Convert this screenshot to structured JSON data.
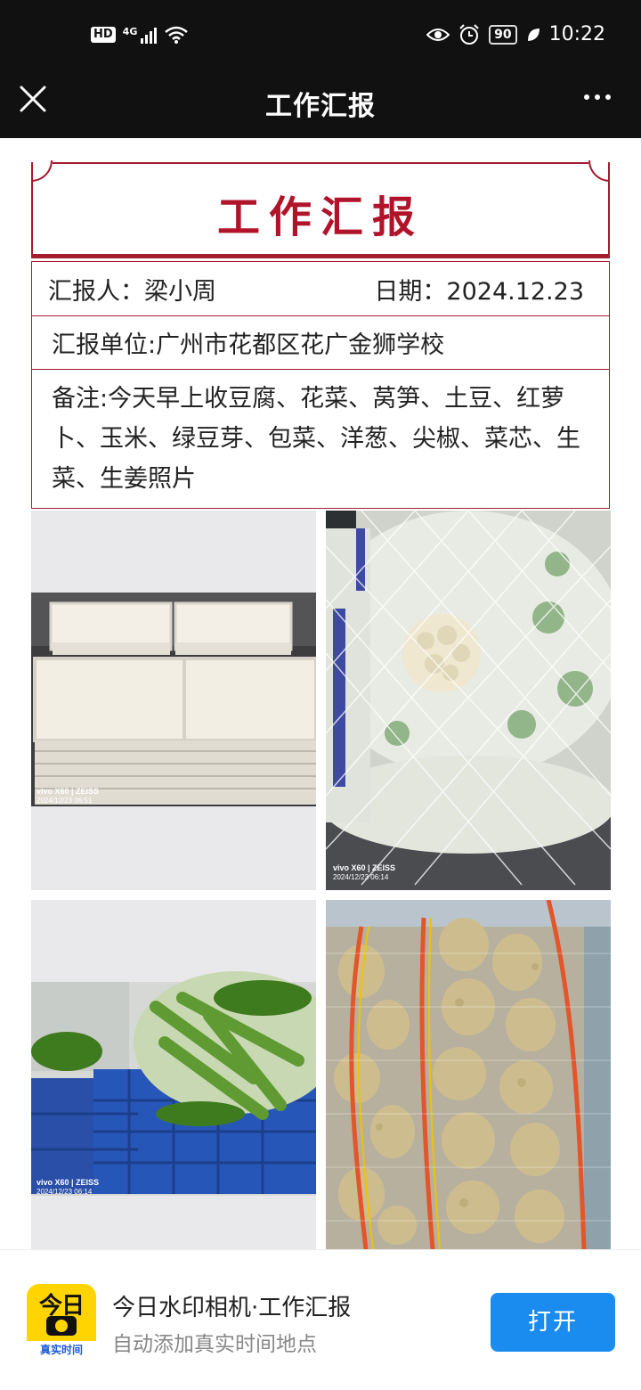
{
  "status_bar": {
    "hd": "HD",
    "network": "4G",
    "battery": "90",
    "time": "10:22",
    "icons": [
      "signal-icon",
      "wifi-icon",
      "eye-icon",
      "alarm-icon",
      "battery-icon",
      "leaf-icon"
    ]
  },
  "nav": {
    "title": "工作汇报",
    "close_icon": "close-icon",
    "more_icon": "more-icon"
  },
  "report": {
    "title": "工作汇报",
    "reporter": "汇报人：梁小周",
    "date": "日期：2024.12.23",
    "unit": "汇报单位:广州市花都区花广金狮学校",
    "note": "备注:今天早上收豆腐、花菜、莴笋、土豆、红萝卜、玉米、绿豆芽、包菜、洋葱、尖椒、菜芯、生菜、生姜照片",
    "accent_color": "#a51c2e"
  },
  "photos": [
    {
      "watermark_brand": "vivo X60 | ZEISS",
      "watermark_time": "2024/12/23 06:51"
    },
    {
      "watermark_brand": "vivo X60 | ZEISS",
      "watermark_time": "2024/12/23 06:14"
    },
    {
      "watermark_brand": "vivo X60 | ZEISS",
      "watermark_time": "2024/12/23 06:14"
    },
    {}
  ],
  "banner": {
    "icon_text": "今日",
    "icon_strip": "真实时间",
    "app_name": "今日水印相机·工作汇报",
    "app_subtitle": "自动添加真实时间地点",
    "open_button": "打开",
    "button_color": "#1a8cf0"
  }
}
